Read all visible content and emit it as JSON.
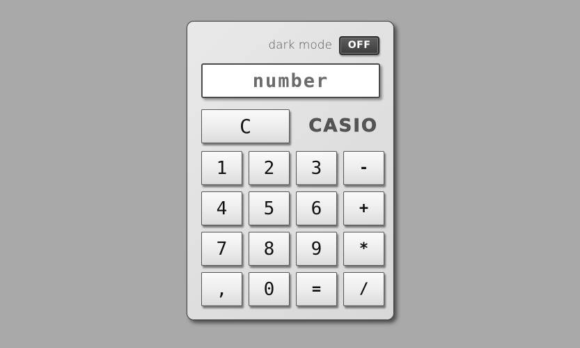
{
  "dark_mode": {
    "label": "dark mode",
    "toggle_state": "OFF"
  },
  "display": {
    "value": "number"
  },
  "clear_button": {
    "label": "C"
  },
  "brand": {
    "name": "CASIO"
  },
  "keypad": {
    "rows": [
      [
        "1",
        "2",
        "3",
        "-"
      ],
      [
        "4",
        "5",
        "6",
        "+"
      ],
      [
        "7",
        "8",
        "9",
        "*"
      ],
      [
        ",",
        "0",
        "=",
        "/"
      ]
    ]
  },
  "colors": {
    "background": "#a9a9a9",
    "body": "#e3e3e3",
    "toggle": "#4a4a4a",
    "display_text": "#6b6b6b",
    "brand_text": "#555555"
  }
}
